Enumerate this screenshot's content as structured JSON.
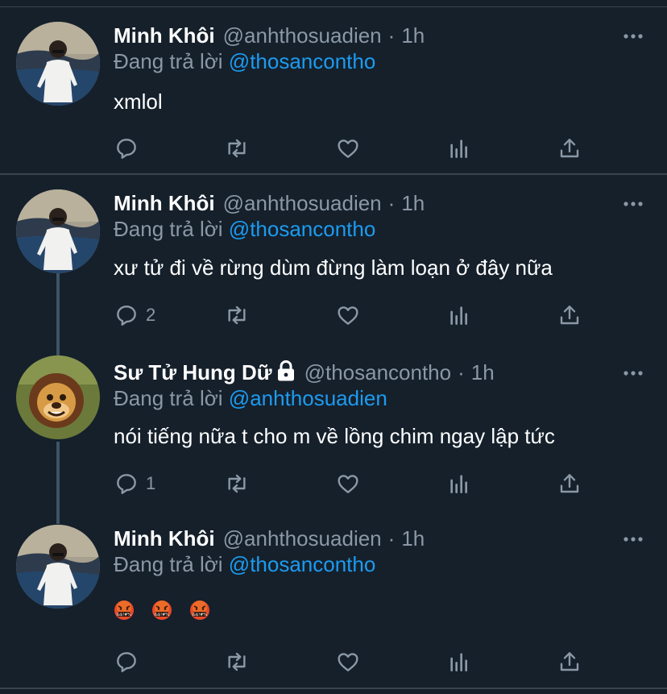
{
  "tweets": [
    {
      "name": "Minh Khôi",
      "handle": "@anhthosuadien",
      "dot": "·",
      "time": "1h",
      "reply_prefix": "Đang trả lời",
      "reply_to": "@thosancontho",
      "text": "xmlol",
      "reply_count": "",
      "avatar": "person-photo"
    },
    {
      "name": "Minh Khôi",
      "handle": "@anhthosuadien",
      "dot": "·",
      "time": "1h",
      "reply_prefix": "Đang trả lời",
      "reply_to": "@thosancontho",
      "text": "xư tử đi về rừng dùm đừng làm loạn ở đây nữa",
      "reply_count": "2",
      "avatar": "person-photo"
    },
    {
      "name": "Sư Tử Hung Dữ",
      "handle": "@thosancontho",
      "dot": "·",
      "time": "1h",
      "reply_prefix": "Đang trả lời",
      "reply_to": "@anhthosuadien",
      "text": "nói tiếng nữa t cho m về lồng chim ngay lập tức",
      "reply_count": "1",
      "avatar": "lion-cartoon"
    },
    {
      "name": "Minh Khôi",
      "handle": "@anhthosuadien",
      "dot": "·",
      "time": "1h",
      "reply_prefix": "Đang trả lời",
      "reply_to": "@thosancontho",
      "text": "",
      "emoji": [
        "cursing-face-emoji",
        "cursing-face-emoji",
        "cursing-face-emoji"
      ],
      "emoji_symbols": "&$!#%",
      "reply_count": "",
      "avatar": "person-photo"
    }
  ],
  "icons": [
    "reply-icon",
    "retweet-icon",
    "like-icon",
    "analytics-icon",
    "share-icon",
    "more-icon",
    "lock-icon"
  ],
  "colors": {
    "background": "#15202b",
    "divider": "#38444d",
    "muted": "#8b98a5",
    "accent": "#1d9bf0",
    "thread": "#3d5466"
  }
}
